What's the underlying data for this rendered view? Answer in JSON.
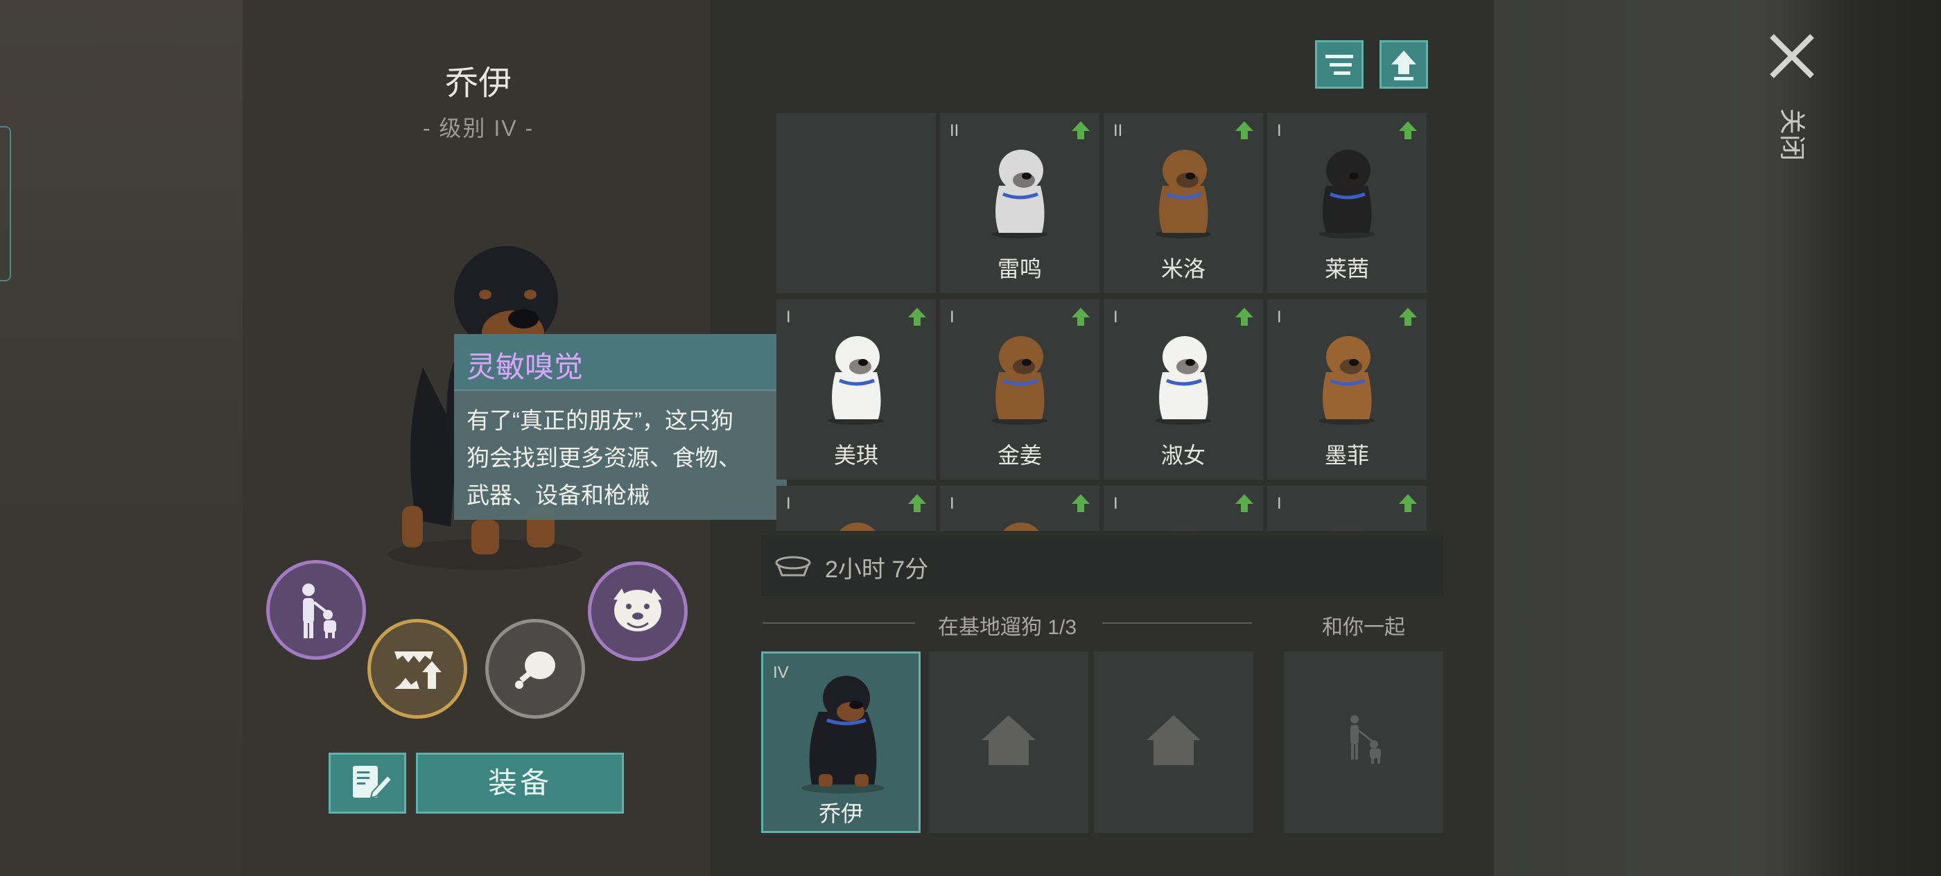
{
  "dog": {
    "name": "乔伊",
    "level": "- 级别 IV -"
  },
  "tooltip": {
    "title": "灵敏嗅觉",
    "lines": [
      "有了“真正的朋友”，这只狗",
      "狗会找到更多资源、食物、",
      "武器、设备和枪械"
    ]
  },
  "skills": [
    "person-with-dog-icon",
    "fang-upgrade-icon",
    "meat-icon",
    "dog-face-icon"
  ],
  "buttons": {
    "equip": "装备",
    "edit": "edit-notes-icon",
    "sort": "sort-icon",
    "upgrade": "upgrade-arrow-icon"
  },
  "grid": [
    {
      "level": "",
      "name": "",
      "empty": true
    },
    {
      "level": "II",
      "name": "雷鸣",
      "color": "#d9d9d9"
    },
    {
      "level": "II",
      "name": "米洛",
      "color": "#8a5a2c"
    },
    {
      "level": "I",
      "name": "莱茜",
      "color": "#222222"
    },
    {
      "level": "I",
      "name": "美琪",
      "color": "#f2f2f0"
    },
    {
      "level": "I",
      "name": "金姜",
      "color": "#8a5a2c"
    },
    {
      "level": "I",
      "name": "淑女",
      "color": "#f2f2f0"
    },
    {
      "level": "I",
      "name": "墨菲",
      "color": "#9a6432"
    },
    {
      "level": "I",
      "name": "",
      "color": "#8a5a2c"
    },
    {
      "level": "I",
      "name": "",
      "color": "#8a5a2c"
    },
    {
      "level": "I",
      "name": "",
      "color": "#3a3a3a"
    },
    {
      "level": "I",
      "name": "",
      "color": "#3a3a3a"
    }
  ],
  "timer": {
    "text": "2小时 7分"
  },
  "walk": {
    "label": "在基地遛狗 1/3",
    "with_you": "和你一起"
  },
  "slots": [
    {
      "level": "IV",
      "name": "乔伊",
      "active": true
    },
    {
      "level": "",
      "name": "",
      "icon": "house-icon"
    },
    {
      "level": "",
      "name": "",
      "icon": "house-icon"
    }
  ],
  "close": {
    "label": "关闭"
  }
}
